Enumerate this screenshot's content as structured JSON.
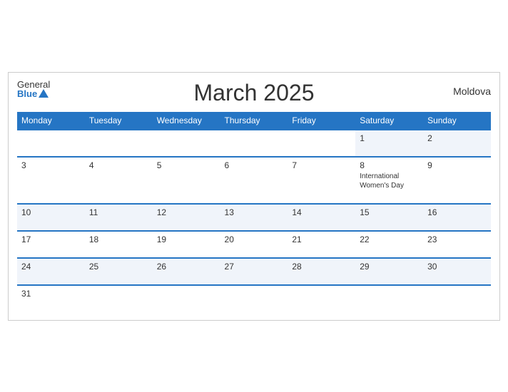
{
  "header": {
    "title": "March 2025",
    "country": "Moldova",
    "logo_general": "General",
    "logo_blue": "Blue"
  },
  "days_of_week": [
    "Monday",
    "Tuesday",
    "Wednesday",
    "Thursday",
    "Friday",
    "Saturday",
    "Sunday"
  ],
  "weeks": [
    [
      {
        "day": "",
        "event": ""
      },
      {
        "day": "",
        "event": ""
      },
      {
        "day": "",
        "event": ""
      },
      {
        "day": "",
        "event": ""
      },
      {
        "day": "",
        "event": ""
      },
      {
        "day": "1",
        "event": ""
      },
      {
        "day": "2",
        "event": ""
      }
    ],
    [
      {
        "day": "3",
        "event": ""
      },
      {
        "day": "4",
        "event": ""
      },
      {
        "day": "5",
        "event": ""
      },
      {
        "day": "6",
        "event": ""
      },
      {
        "day": "7",
        "event": ""
      },
      {
        "day": "8",
        "event": "International Women's Day"
      },
      {
        "day": "9",
        "event": ""
      }
    ],
    [
      {
        "day": "10",
        "event": ""
      },
      {
        "day": "11",
        "event": ""
      },
      {
        "day": "12",
        "event": ""
      },
      {
        "day": "13",
        "event": ""
      },
      {
        "day": "14",
        "event": ""
      },
      {
        "day": "15",
        "event": ""
      },
      {
        "day": "16",
        "event": ""
      }
    ],
    [
      {
        "day": "17",
        "event": ""
      },
      {
        "day": "18",
        "event": ""
      },
      {
        "day": "19",
        "event": ""
      },
      {
        "day": "20",
        "event": ""
      },
      {
        "day": "21",
        "event": ""
      },
      {
        "day": "22",
        "event": ""
      },
      {
        "day": "23",
        "event": ""
      }
    ],
    [
      {
        "day": "24",
        "event": ""
      },
      {
        "day": "25",
        "event": ""
      },
      {
        "day": "26",
        "event": ""
      },
      {
        "day": "27",
        "event": ""
      },
      {
        "day": "28",
        "event": ""
      },
      {
        "day": "29",
        "event": ""
      },
      {
        "day": "30",
        "event": ""
      }
    ],
    [
      {
        "day": "31",
        "event": ""
      },
      {
        "day": "",
        "event": ""
      },
      {
        "day": "",
        "event": ""
      },
      {
        "day": "",
        "event": ""
      },
      {
        "day": "",
        "event": ""
      },
      {
        "day": "",
        "event": ""
      },
      {
        "day": "",
        "event": ""
      }
    ]
  ]
}
